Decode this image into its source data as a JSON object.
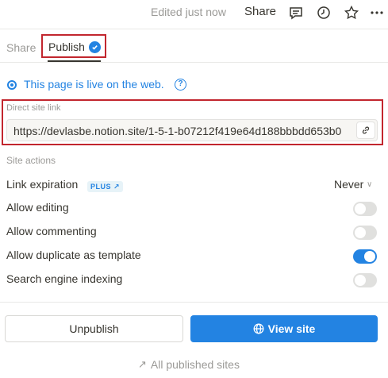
{
  "topbar": {
    "edited": "Edited just now",
    "share": "Share",
    "icons": [
      "comment-icon",
      "clock-icon",
      "star-icon",
      "more-icon"
    ]
  },
  "tabs": [
    {
      "label": "Share",
      "active": false
    },
    {
      "label": "Publish",
      "active": true
    }
  ],
  "status": {
    "text": "This page is live on the web.",
    "help": "?"
  },
  "direct_link": {
    "label": "Direct site link",
    "url": "https://devlasbe.notion.site/1-5-1-b07212f419e64d188bbbdd653b0"
  },
  "site_actions": {
    "heading": "Site actions",
    "link_expiration": {
      "label": "Link expiration",
      "badge": "PLUS ↗",
      "value": "Never",
      "chevron": "∨"
    },
    "toggles": [
      {
        "label": "Allow editing",
        "on": false
      },
      {
        "label": "Allow commenting",
        "on": false
      },
      {
        "label": "Allow duplicate as template",
        "on": true
      },
      {
        "label": "Search engine indexing",
        "on": false
      }
    ]
  },
  "buttons": {
    "unpublish": "Unpublish",
    "view_site": "View site"
  },
  "footer": {
    "all_sites": "All published sites",
    "arrow": "↗"
  },
  "colors": {
    "accent": "#2383e2",
    "highlight": "#c2262e"
  }
}
